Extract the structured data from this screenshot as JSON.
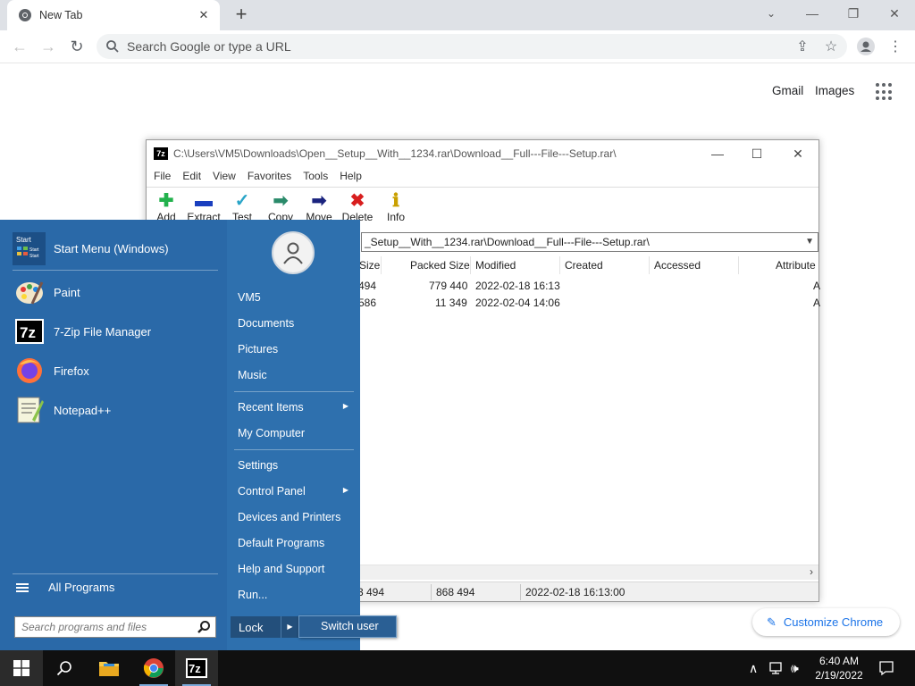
{
  "browser": {
    "tab_title": "New Tab",
    "omnibox_placeholder": "Search Google or type a URL",
    "ntp_links": {
      "gmail": "Gmail",
      "images": "Images"
    },
    "customize_label": "Customize Chrome"
  },
  "sevenzip": {
    "title": "C:\\Users\\VM5\\Downloads\\Open__Setup__With__1234.rar\\Download__Full---File---Setup.rar\\",
    "menu": [
      "File",
      "Edit",
      "View",
      "Favorites",
      "Tools",
      "Help"
    ],
    "toolbar": {
      "add": "Add",
      "extract": "Extract",
      "test": "Test",
      "copy": "Copy",
      "move": "Move",
      "delete": "Delete",
      "info": "Info"
    },
    "path": "_Setup__With__1234.rar\\Download__Full---File---Setup.rar\\",
    "columns": {
      "size": "Size",
      "packed": "Packed Size",
      "modified": "Modified",
      "created": "Created",
      "accessed": "Accessed",
      "attributes": "Attribute"
    },
    "rows": [
      {
        "size": "494",
        "packed": "779 440",
        "modified": "2022-02-18 16:13",
        "attr": "A"
      },
      {
        "size": "586",
        "packed": "11 349",
        "modified": "2022-02-04 14:06",
        "attr": "A"
      }
    ],
    "status": {
      "size": "3 494",
      "packed": "868 494",
      "modified": "2022-02-18 16:13:00"
    }
  },
  "start_menu": {
    "pinned": [
      {
        "label": "Start Menu (Windows)",
        "icon": "start-menu-icon"
      },
      {
        "label": "Paint",
        "icon": "paint-icon"
      },
      {
        "label": "7-Zip File Manager",
        "icon": "7zip-icon"
      },
      {
        "label": "Firefox",
        "icon": "firefox-icon"
      },
      {
        "label": "Notepad++",
        "icon": "notepadpp-icon"
      }
    ],
    "start_icon_text": [
      "Start",
      "Start",
      "Start"
    ],
    "all_programs": "All Programs",
    "search_placeholder": "Search programs and files",
    "right": {
      "user": "VM5",
      "documents": "Documents",
      "pictures": "Pictures",
      "music": "Music",
      "recent": "Recent Items",
      "computer": "My Computer",
      "settings": "Settings",
      "control_panel": "Control Panel",
      "devices": "Devices and Printers",
      "defaults": "Default Programs",
      "help": "Help and Support",
      "run": "Run..."
    },
    "lock": "Lock",
    "switch_user": "Switch user"
  },
  "taskbar": {
    "time": "6:40 AM",
    "date": "2/19/2022",
    "sevenzip_icon_text": "7z"
  },
  "colors": {
    "start_bg": "#2a69a8",
    "taskbar_bg": "#101010",
    "accent": "#1a73e8"
  }
}
